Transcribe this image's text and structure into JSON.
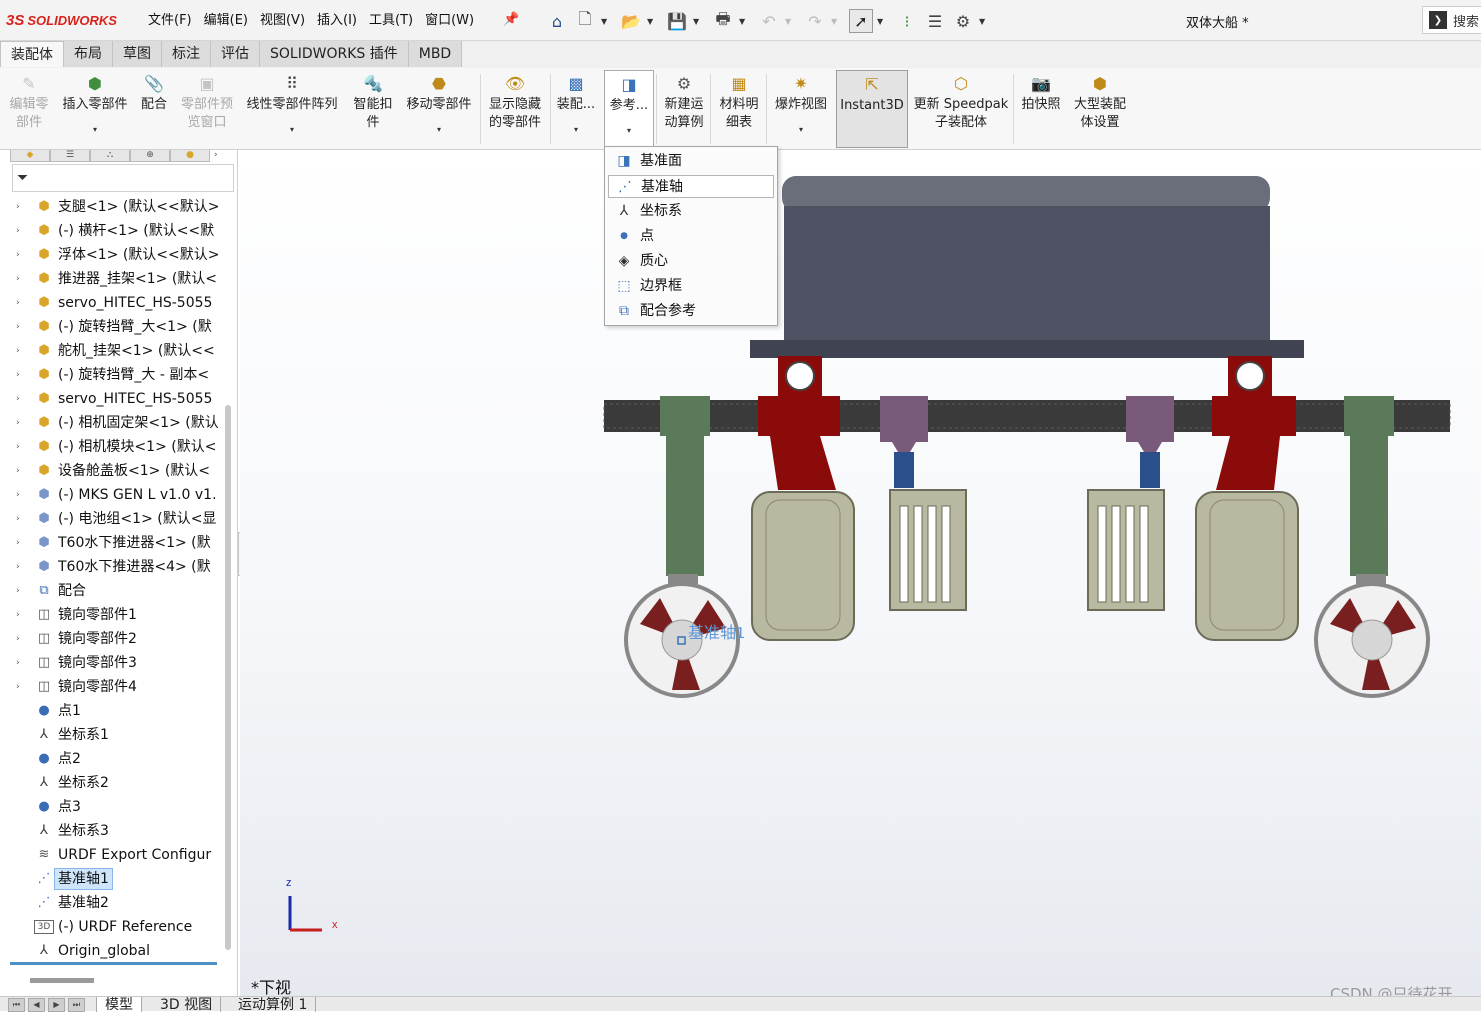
{
  "app": {
    "logo_text": "SOLIDWORKS",
    "logo_mark": "3S",
    "document_title": "双体大船 *",
    "search_placeholder": "搜索"
  },
  "menubar": [
    "文件(F)",
    "编辑(E)",
    "视图(V)",
    "插入(I)",
    "工具(T)",
    "窗口(W)"
  ],
  "cm_tabs": [
    {
      "label": "装配体",
      "active": true
    },
    {
      "label": "布局"
    },
    {
      "label": "草图"
    },
    {
      "label": "标注"
    },
    {
      "label": "评估"
    },
    {
      "label": "SOLIDWORKS 插件"
    },
    {
      "label": "MBD"
    }
  ],
  "ribbon": {
    "edit_part": [
      "编辑零",
      "部件"
    ],
    "insert_part": "插入零部件",
    "mate": "配合",
    "preview_window": [
      "零部件预",
      "览窗口"
    ],
    "linear_pattern": "线性零部件阵列",
    "smart_fastener": [
      "智能扣",
      "件"
    ],
    "move_part": "移动零部件",
    "show_hidden": [
      "显示隐藏",
      "的零部件"
    ],
    "assembly_features": "装配...",
    "reference_geometry": "参考...",
    "new_motion_study": [
      "新建运",
      "动算例"
    ],
    "bom": [
      "材料明",
      "细表"
    ],
    "exploded_view": "爆炸视图",
    "instant3d": "Instant3D",
    "speedpak": [
      "更新 Speedpak",
      "子装配体"
    ],
    "snapshot": "拍快照",
    "large_assembly": [
      "大型装配",
      "体设置"
    ]
  },
  "reference_menu": [
    {
      "label": "基准面",
      "icon": "plane-icon"
    },
    {
      "label": "基准轴",
      "icon": "axis-icon",
      "hover": true
    },
    {
      "label": "坐标系",
      "icon": "coordinate-system-icon"
    },
    {
      "label": "点",
      "icon": "point-icon"
    },
    {
      "label": "质心",
      "icon": "center-of-mass-icon"
    },
    {
      "label": "边界框",
      "icon": "bounding-box-icon"
    },
    {
      "label": "配合参考",
      "icon": "mate-reference-icon"
    }
  ],
  "tree": [
    {
      "label": "支腿<1> (默认<<默认>",
      "icon": "part",
      "expand": true
    },
    {
      "label": "(-) 横杆<1> (默认<<默",
      "icon": "part",
      "expand": true
    },
    {
      "label": "浮体<1> (默认<<默认>",
      "icon": "part",
      "expand": true
    },
    {
      "label": "推进器_挂架<1> (默认<",
      "icon": "part",
      "expand": true
    },
    {
      "label": "servo_HITEC_HS-5055",
      "icon": "part",
      "expand": true
    },
    {
      "label": "(-) 旋转挡臂_大<1> (默",
      "icon": "part",
      "expand": true
    },
    {
      "label": "舵机_挂架<1> (默认<<",
      "icon": "part",
      "expand": true
    },
    {
      "label": "(-) 旋转挡臂_大 - 副本<",
      "icon": "part",
      "expand": true
    },
    {
      "label": "servo_HITEC_HS-5055",
      "icon": "part",
      "expand": true
    },
    {
      "label": "(-) 相机固定架<1> (默认",
      "icon": "part",
      "expand": true
    },
    {
      "label": "(-) 相机模块<1> (默认<",
      "icon": "part",
      "expand": true
    },
    {
      "label": "设备舱盖板<1> (默认<",
      "icon": "part",
      "expand": true
    },
    {
      "label": "(-) MKS GEN L v1.0 v1.",
      "icon": "subassembly",
      "expand": true
    },
    {
      "label": "(-) 电池组<1> (默认<显",
      "icon": "subassembly",
      "expand": true
    },
    {
      "label": "T60水下推进器<1> (默",
      "icon": "subassembly",
      "expand": true
    },
    {
      "label": "T60水下推进器<4> (默",
      "icon": "subassembly",
      "expand": true
    },
    {
      "label": "配合",
      "icon": "mate",
      "expand": true
    },
    {
      "label": "镜向零部件1",
      "icon": "mirror",
      "expand": true
    },
    {
      "label": "镜向零部件2",
      "icon": "mirror",
      "expand": true
    },
    {
      "label": "镜向零部件3",
      "icon": "mirror",
      "expand": true
    },
    {
      "label": "镜向零部件4",
      "icon": "mirror",
      "expand": true
    },
    {
      "label": "点1",
      "icon": "point",
      "expand": false
    },
    {
      "label": "坐标系1",
      "icon": "coord",
      "expand": false
    },
    {
      "label": "点2",
      "icon": "point",
      "expand": false
    },
    {
      "label": "坐标系2",
      "icon": "coord",
      "expand": false
    },
    {
      "label": "点3",
      "icon": "point",
      "expand": false
    },
    {
      "label": "坐标系3",
      "icon": "coord",
      "expand": false
    },
    {
      "label": "URDF Export Configur",
      "icon": "urdf",
      "expand": false
    },
    {
      "label": "基准轴1",
      "icon": "axis",
      "expand": false,
      "selected": true
    },
    {
      "label": "基准轴2",
      "icon": "axis",
      "expand": false
    },
    {
      "label": "(-) URDF Reference",
      "icon": "urdf3d",
      "expand": false
    },
    {
      "label": "Origin_global",
      "icon": "coord",
      "expand": false
    }
  ],
  "viewport": {
    "view_name": "*下视",
    "axis_annotation": "基准轴1",
    "triad": {
      "z": "z",
      "x": "x"
    }
  },
  "bottom_tabs": [
    {
      "label": "模型",
      "active": true
    },
    {
      "label": "3D 视图"
    },
    {
      "label": "运动算例 1"
    }
  ],
  "watermark": "CSDN @只待花开",
  "colors": {
    "logo_red": "#d8231c",
    "hull_box": "#4e5263",
    "crossbar": "#3a3a3a",
    "leg_green": "#5a7a5a",
    "mount_red": "#8b0b0b",
    "float_khaki": "#b9b8a0",
    "servo_purple": "#7a5a7a",
    "propeller_red": "#7a1f1f",
    "selection_blue": "#cde4fb"
  }
}
